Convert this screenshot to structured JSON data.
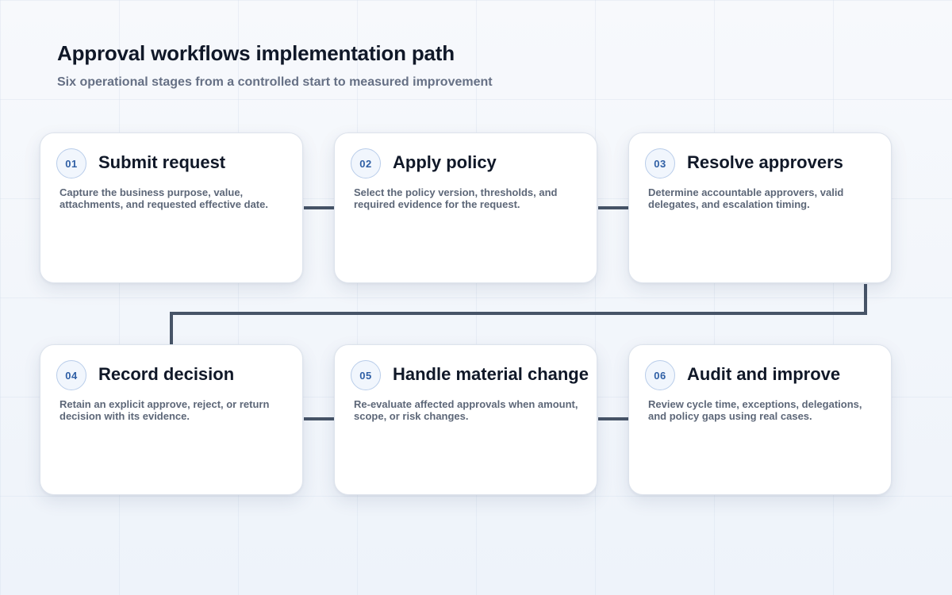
{
  "header": {
    "title": "Approval workflows implementation path",
    "subtitle": "Six operational stages from a controlled start to measured improvement"
  },
  "colors": {
    "connector": "#475467",
    "badge_text": "#2f5fa5",
    "badge_border": "#b9cdea",
    "card_background": "#ffffff",
    "title_text": "#101828",
    "body_text": "#5d6778"
  },
  "stages": [
    {
      "number": "01",
      "title": "Submit request",
      "description": "Capture the business purpose, value, attachments, and requested effective date."
    },
    {
      "number": "02",
      "title": "Apply policy",
      "description": "Select the policy version, thresholds, and required evidence for the request."
    },
    {
      "number": "03",
      "title": "Resolve approvers",
      "description": "Determine accountable approvers, valid delegates, and escalation timing."
    },
    {
      "number": "04",
      "title": "Record decision",
      "description": "Retain an explicit approve, reject, or return decision with its evidence."
    },
    {
      "number": "05",
      "title": "Handle material change",
      "description": "Re-evaluate affected approvals when amount, scope, or risk changes."
    },
    {
      "number": "06",
      "title": "Audit and improve",
      "description": "Review cycle time, exceptions, delegations, and policy gaps using real cases."
    }
  ]
}
